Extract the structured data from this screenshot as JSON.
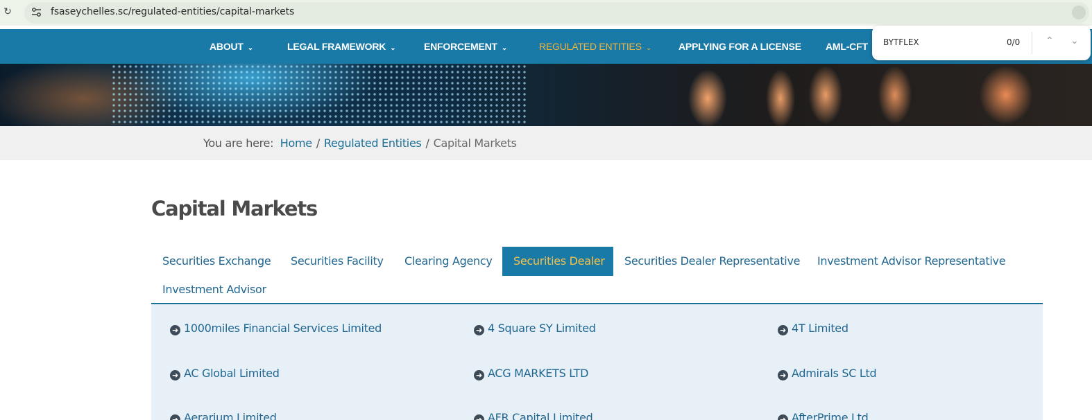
{
  "browser": {
    "url": "fsaseychelles.sc/regulated-entities/capital-markets",
    "find_query": "BYTFLEX",
    "find_count": "0/0"
  },
  "nav": {
    "items": [
      {
        "label": "ABOUT",
        "has_menu": true
      },
      {
        "label": "LEGAL FRAMEWORK",
        "has_menu": true
      },
      {
        "label": "ENFORCEMENT",
        "has_menu": true
      },
      {
        "label": "REGULATED ENTITIES",
        "has_menu": true,
        "active": true
      },
      {
        "label": "APPLYING FOR A LICENSE",
        "has_menu": false
      },
      {
        "label": "AML-CFT",
        "has_menu": false
      }
    ],
    "active_color": "#f0b43a"
  },
  "breadcrumb": {
    "prefix": "You are here:",
    "items": [
      "Home",
      "Regulated Entities",
      "Capital Markets"
    ]
  },
  "page": {
    "title": "Capital Markets"
  },
  "tabs": [
    {
      "label": "Securities Exchange"
    },
    {
      "label": "Securities Facility"
    },
    {
      "label": "Clearing Agency"
    },
    {
      "label": "Securities Dealer",
      "active": true
    },
    {
      "label": "Securities Dealer Representative"
    },
    {
      "label": "Investment Advisor Representative"
    },
    {
      "label": "Investment Advisor"
    }
  ],
  "entities": [
    "1000miles Financial Services Limited",
    "4 Square SY Limited",
    "4T Limited",
    "AC Global Limited",
    "ACG MARKETS LTD",
    "Admirals SC Ltd",
    "Aerarium Limited",
    "AFR Capital Limited",
    "AfterPrime Ltd"
  ],
  "colors": {
    "brand": "#1a7aa7",
    "link": "#1f6690",
    "accent": "#f4c24b"
  }
}
